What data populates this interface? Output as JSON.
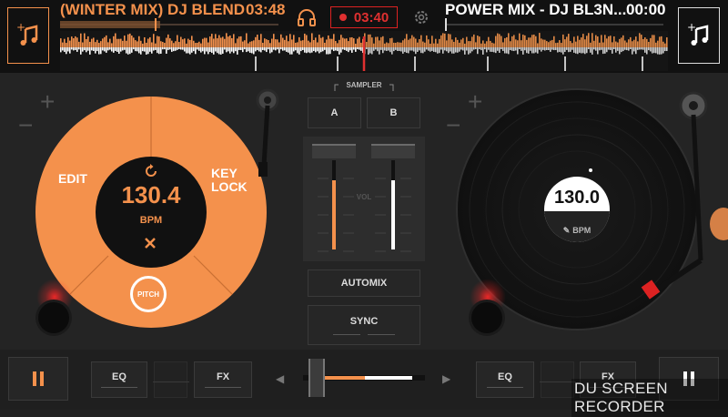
{
  "colors": {
    "accent": "#f4914c",
    "record_red": "#e03030",
    "white": "#ffffff"
  },
  "top_bar": {
    "left_track": {
      "title": "(WINTER MIX) DJ BLEND",
      "time": "03:48"
    },
    "right_track": {
      "title": "POWER MIX - DJ BL3N...",
      "time": "00:00"
    },
    "record_time": "03:40",
    "icons": {
      "headphones": "headphones-icon",
      "record": "record-icon",
      "settings": "gear-icon",
      "add_track": "add-music-icon"
    }
  },
  "left_deck": {
    "bpm": "130.4",
    "bpm_label": "BPM",
    "edit_label": "EDIT",
    "key_lock_line1": "KEY",
    "key_lock_line2": "LOCK",
    "pitch_label": "PITCH",
    "plus": "+",
    "minus": "−"
  },
  "right_deck": {
    "bpm": "130.0",
    "bpm_label": "BPM",
    "plus": "+",
    "minus": "−"
  },
  "mixer": {
    "sampler_label": "SAMPLER",
    "sampler_a": "A",
    "sampler_b": "B",
    "vol_label": "VOL",
    "automix_label": "AUTOMIX",
    "sync_label": "SYNC",
    "left_volume": 0.78,
    "right_volume": 0.78
  },
  "bottom_bar": {
    "left": {
      "eq": "EQ",
      "fx": "FX"
    },
    "right": {
      "eq": "EQ",
      "fx": "FX"
    },
    "crossfader_position": 0.05
  },
  "watermark": "DU SCREEN RECORDER"
}
